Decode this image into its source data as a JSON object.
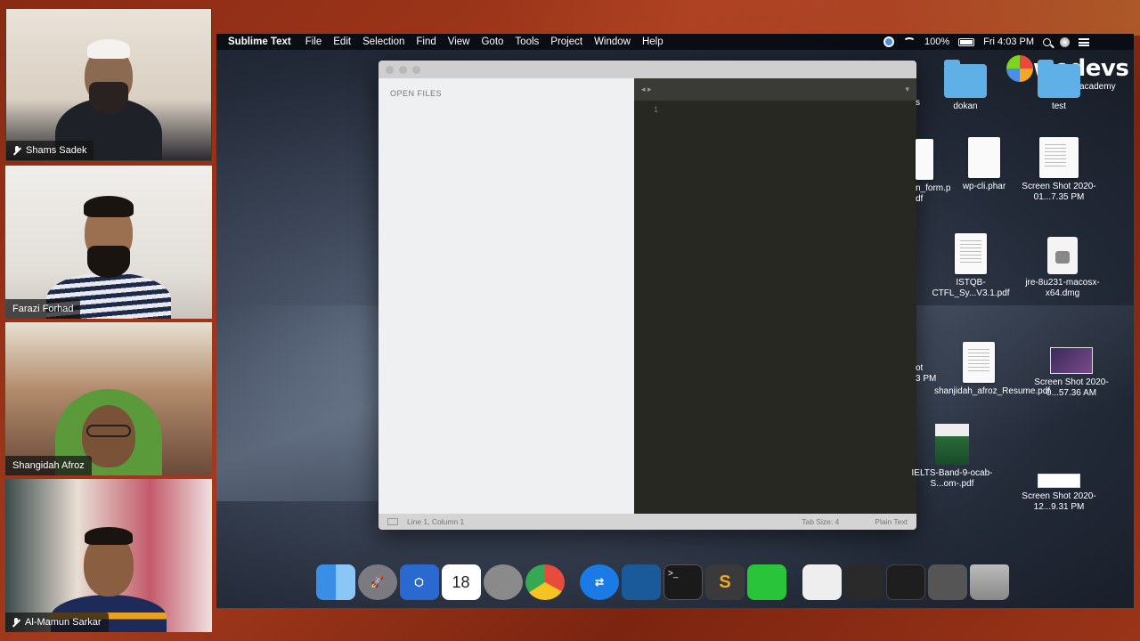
{
  "participants": [
    {
      "name": "Shams Sadek",
      "muted": true
    },
    {
      "name": "Farazi Forhad",
      "muted": false
    },
    {
      "name": "Shangidah Afroz",
      "muted": false
    },
    {
      "name": "Al-Mamun Sarkar",
      "muted": true
    }
  ],
  "menubar": {
    "app_name": "Sublime Text",
    "items": [
      "File",
      "Edit",
      "Selection",
      "Find",
      "View",
      "Goto",
      "Tools",
      "Project",
      "Window",
      "Help"
    ],
    "battery": "100%",
    "clock": "Fri 4:03 PM"
  },
  "sublime": {
    "sidebar_title": "OPEN FILES",
    "line_number": "1",
    "tab_arrows": "◂ ▸",
    "status_left": "Line 1, Column 1",
    "status_tab_size": "Tab Size: 4",
    "status_syntax": "Plain Text"
  },
  "logo": {
    "word": "wedevs",
    "sub": "academy"
  },
  "desktop": {
    "dokan": "dokan",
    "test": "test",
    "s_label": "s",
    "form_line1": "n_form.p",
    "form_line2": "df",
    "wpcli": "wp-cli.phar",
    "shot1": "Screen Shot 2020-01...7.35 PM",
    "istqb": "ISTQB-CTFL_Sy...V3.1.pdf",
    "jre": "jre-8u231-macosx-x64.dmg",
    "ot_line1": "ot",
    "ot_line2": "3 PM",
    "resume": "shanjidah_afroz_Resume.pdf",
    "shot2": "Screen Shot 2020-0...57.36 AM",
    "ielts": "IELTS-Band-9-ocab-S...om-.pdf",
    "shot3": "Screen Shot 2020-12...9.31 PM"
  },
  "dock": {
    "calendar_day": "18",
    "terminal_prompt": ">_"
  },
  "colors": {
    "accent": "#5fb0e6",
    "sublime_bg": "#272822",
    "brand_bg": "#8a2a14"
  }
}
